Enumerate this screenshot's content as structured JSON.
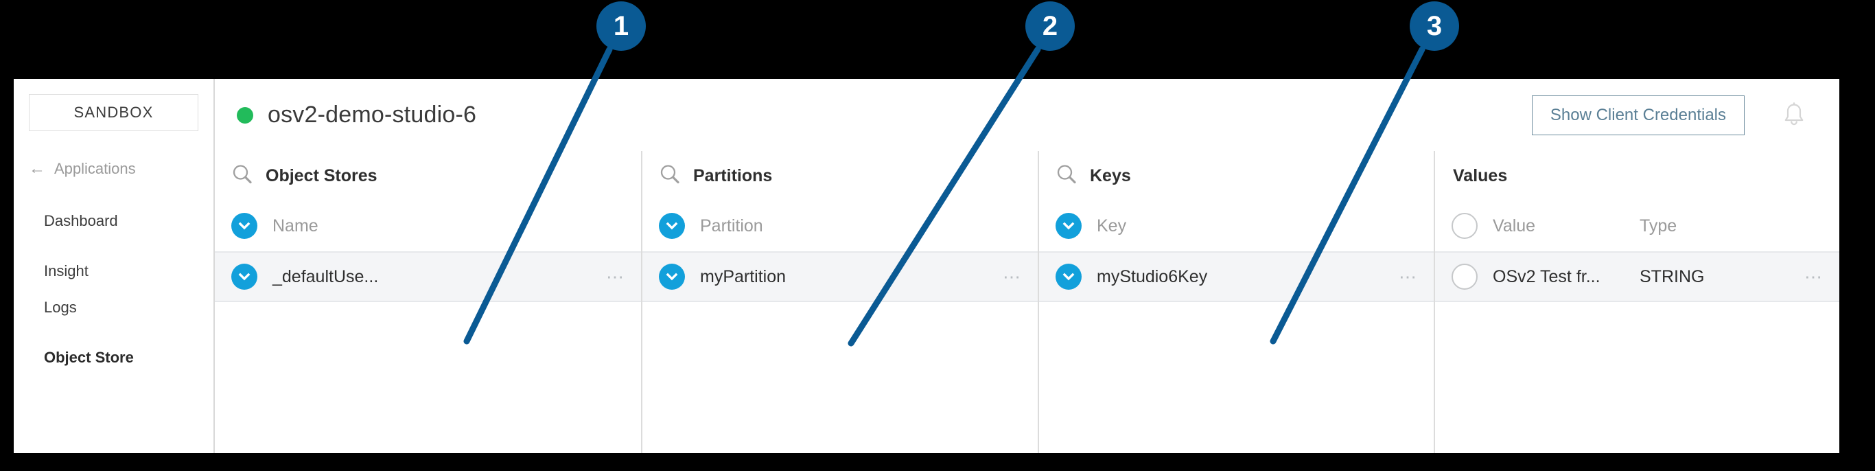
{
  "sidebar": {
    "environment_button": "SANDBOX",
    "back_link": "Applications",
    "back_icon": "arrow-left-icon",
    "items": [
      {
        "label": "Dashboard",
        "active": false
      },
      {
        "label": "Insight",
        "active": false
      },
      {
        "label": "Logs",
        "active": false
      },
      {
        "label": "Object Store",
        "active": true
      }
    ]
  },
  "header": {
    "status_icon": "status-dot-online",
    "status_color": "#22bb5b",
    "title": "osv2-demo-studio-6",
    "credentials_button": "Show Client Credentials",
    "notification_icon": "bell-icon"
  },
  "columns": [
    {
      "title": "Object Stores",
      "search_icon": "search-icon",
      "has_search": true,
      "header_row": {
        "label": "Name",
        "selector": "chevron-circle-icon",
        "selected": true
      },
      "rows": [
        {
          "value": "_defaultUse...",
          "selector": "chevron-circle-icon",
          "selected": true,
          "menu_icon": "overflow-menu-icon"
        }
      ]
    },
    {
      "title": "Partitions",
      "search_icon": "search-icon",
      "has_search": true,
      "header_row": {
        "label": "Partition",
        "selector": "chevron-circle-icon",
        "selected": true
      },
      "rows": [
        {
          "value": "myPartition",
          "selector": "chevron-circle-icon",
          "selected": true,
          "menu_icon": "overflow-menu-icon"
        }
      ]
    },
    {
      "title": "Keys",
      "search_icon": "search-icon",
      "has_search": true,
      "header_row": {
        "label": "Key",
        "selector": "chevron-circle-icon",
        "selected": true
      },
      "rows": [
        {
          "value": "myStudio6Key",
          "selector": "chevron-circle-icon",
          "selected": true,
          "menu_icon": "overflow-menu-icon"
        }
      ]
    },
    {
      "title": "Values",
      "search_icon": "",
      "has_search": false,
      "header_row": {
        "label": "Value",
        "label2": "Type",
        "selector": "empty-circle-icon",
        "selected": false
      },
      "rows": [
        {
          "value": "OSv2 Test fr...",
          "value2": "STRING",
          "selector": "empty-circle-icon",
          "selected": false,
          "menu_icon": "overflow-menu-icon"
        }
      ]
    }
  ],
  "callouts": [
    {
      "number": "1"
    },
    {
      "number": "2"
    },
    {
      "number": "3"
    }
  ],
  "colors": {
    "accent_blue": "#12a0db",
    "callout_blue": "#0a5a94",
    "status_green": "#22bb5b",
    "nav_active_bar": "#00a0e0"
  }
}
